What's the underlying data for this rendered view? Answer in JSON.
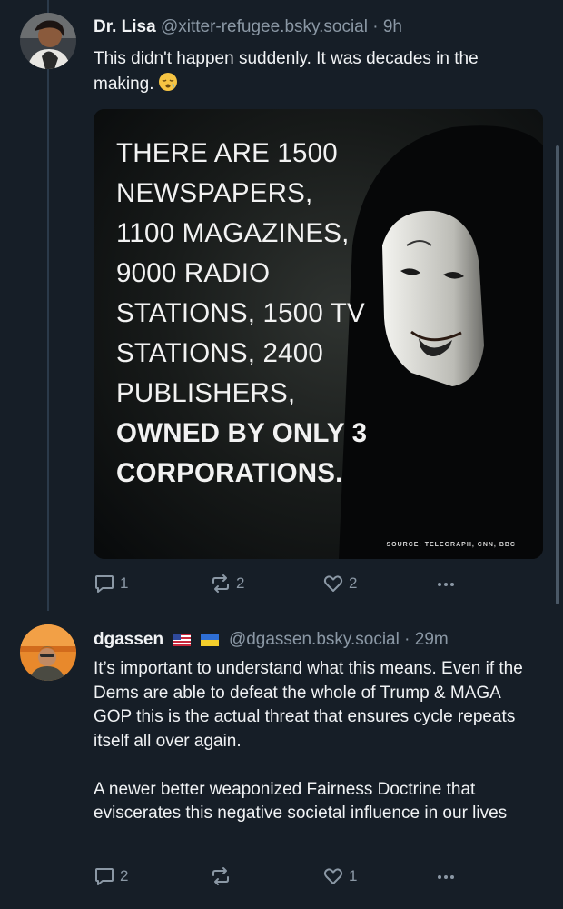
{
  "posts": [
    {
      "author_name": "Dr. Lisa",
      "handle": "@xitter-refugee.bsky.social",
      "separator": "·",
      "time": "9h",
      "text": "This didn't happen suddenly. It was decades in the making.",
      "emoji_icon": "sleepy-face-emoji",
      "image": {
        "lines": [
          "THERE ARE 1500",
          "NEWSPAPERS,",
          "1100 MAGAZINES,",
          "9000 RADIO",
          "STATIONS, 1500 TV",
          "STATIONS, 2400",
          "PUBLISHERS,"
        ],
        "bold_lines": [
          "OWNED BY ONLY 3",
          "CORPORATIONS."
        ],
        "source": "SOURCE: TELEGRAPH, CNN, BBC"
      },
      "replies": "1",
      "reposts": "2",
      "likes": "2"
    },
    {
      "author_name": "dgassen",
      "flags": [
        "us-flag-icon",
        "ukraine-flag-icon"
      ],
      "handle": "@dgassen.bsky.social",
      "separator": "·",
      "time": "29m",
      "text": "It’s important to understand what this means. Even if the Dems are able to defeat the whole of Trump & MAGA GOP this is the actual threat that ensures cycle repeats itself all over again.\n\nA newer better weaponized Fairness Doctrine that eviscerates this negative societal influence in our lives",
      "replies": "2",
      "reposts": "",
      "likes": "1"
    }
  ],
  "colors": {
    "background": "#161e27",
    "muted": "#8b98a5",
    "text": "#f1f3f5",
    "thread_line": "#2b3a4a"
  }
}
